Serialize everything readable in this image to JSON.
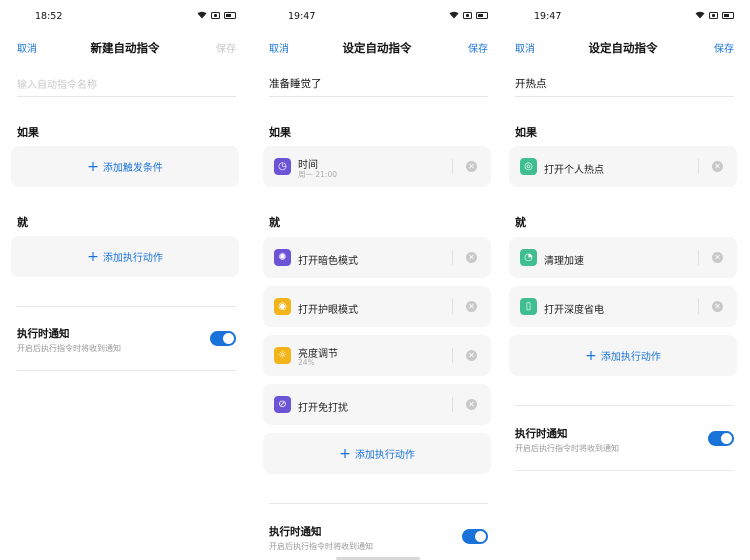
{
  "screen1": {
    "time": "18:52",
    "nav": {
      "cancel": "取消",
      "title": "新建自动指令",
      "save": "保存"
    },
    "name_placeholder": "输入自动指令名称",
    "if_label": "如果",
    "add_trigger": "添加触发条件",
    "then_label": "就",
    "add_action": "添加执行动作",
    "notify_title": "执行时通知",
    "notify_sub": "开启后执行指令时将收到通知",
    "notify_on": true
  },
  "screen2": {
    "time": "19:47",
    "nav": {
      "cancel": "取消",
      "title": "设定自动指令",
      "save": "保存"
    },
    "name_value": "准备睡觉了",
    "if_label": "如果",
    "trigger": {
      "title": "时间",
      "sub": "周一 21:00",
      "icon": "clock-icon",
      "color": "#6b55d6"
    },
    "then_label": "就",
    "actions": [
      {
        "title": "打开暗色模式",
        "icon": "dark-mode-icon",
        "color": "#6b55d6"
      },
      {
        "title": "打开护眼模式",
        "icon": "eye-care-icon",
        "color": "#f2b419"
      },
      {
        "title": "亮度调节",
        "sub": "24%",
        "icon": "brightness-icon",
        "color": "#f2b419"
      },
      {
        "title": "打开免打扰",
        "icon": "do-not-disturb-icon",
        "color": "#6b55d6"
      }
    ],
    "add_action": "添加执行动作",
    "notify_title": "执行时通知",
    "notify_sub": "开启后执行指令时将收到通知",
    "notify_on": true
  },
  "screen3": {
    "time": "19:47",
    "nav": {
      "cancel": "取消",
      "title": "设定自动指令",
      "save": "保存"
    },
    "name_value": "开热点",
    "if_label": "如果",
    "trigger": {
      "title": "打开个人热点",
      "icon": "hotspot-icon",
      "color": "#3fbf8f"
    },
    "then_label": "就",
    "actions": [
      {
        "title": "清理加速",
        "icon": "speed-up-icon",
        "color": "#3fbf8f"
      },
      {
        "title": "打开深度省电",
        "icon": "battery-saver-icon",
        "color": "#3fbf8f"
      }
    ],
    "add_action": "添加执行动作",
    "notify_title": "执行时通知",
    "notify_sub": "开启后执行指令时将收到通知",
    "notify_on": true
  }
}
